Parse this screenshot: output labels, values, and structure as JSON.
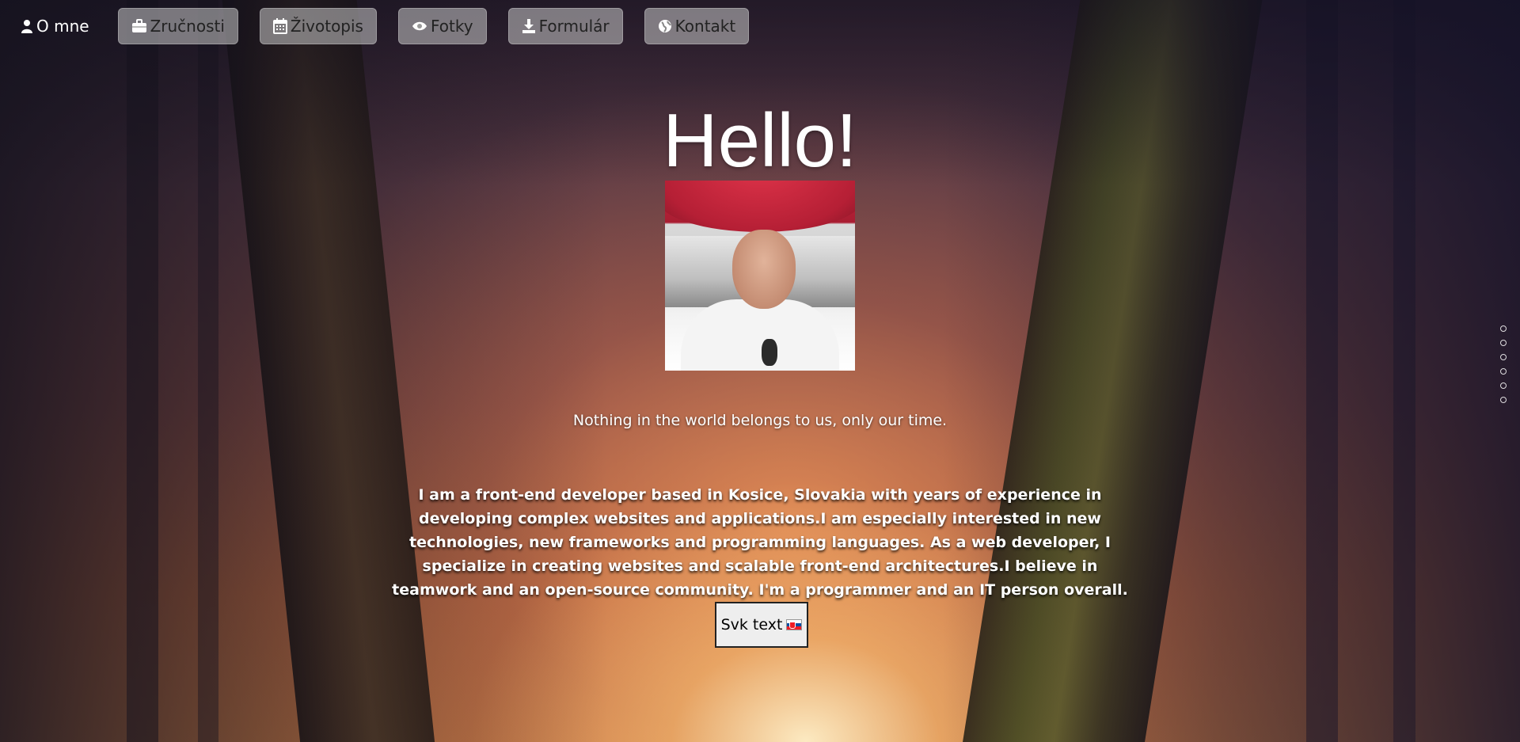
{
  "nav": {
    "brand": {
      "label": "O mne",
      "icon": "user-icon"
    },
    "buttons": [
      {
        "label": "Zručnosti",
        "icon": "briefcase-icon"
      },
      {
        "label": "Životopis",
        "icon": "calendar-icon"
      },
      {
        "label": "Fotky",
        "icon": "eye-icon"
      },
      {
        "label": "Formulár",
        "icon": "download-icon"
      },
      {
        "label": "Kontakt",
        "icon": "globe-icon"
      }
    ]
  },
  "hero": {
    "title": "Hello!",
    "quote": "Nothing in the world belongs to us, only our time.",
    "bio": "I am a front-end developer based in Kosice, Slovakia with years of experience in developing complex websites and applications.I am especially interested in new technologies, new frameworks and programming languages. As a web developer, I specialize in creating websites and scalable front-end architectures.I believe in teamwork and an open-source community. I'm a programmer and an IT person overall.",
    "lang_button": "Svk text"
  },
  "side_nav": {
    "dot_count": 6
  }
}
